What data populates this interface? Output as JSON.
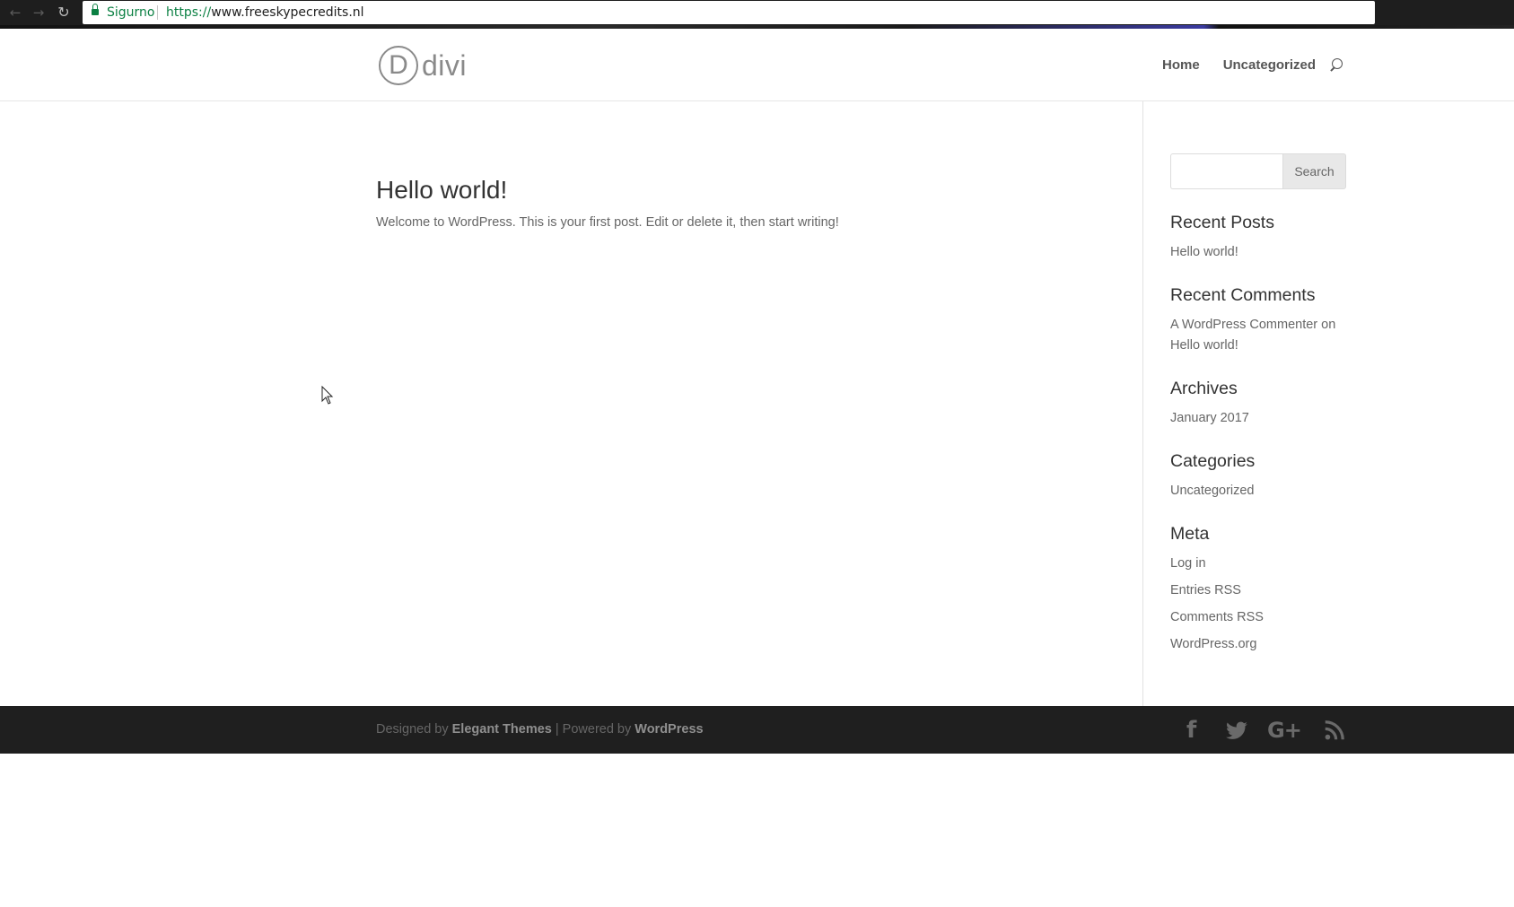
{
  "browser": {
    "back_icon": "arrow-left-icon",
    "forward_icon": "arrow-right-icon",
    "reload_icon": "reload-icon",
    "secure_label": "Sigurno",
    "url_scheme": "https://",
    "url_rest": "www.freeskypecredits.nl"
  },
  "header": {
    "logo_mark": "D",
    "logo_text": "divi",
    "nav": [
      "Home",
      "Uncategorized"
    ],
    "search_icon": "search-icon"
  },
  "post": {
    "title": "Hello world!",
    "excerpt": "Welcome to WordPress. This is your first post. Edit or delete it, then start writing!"
  },
  "sidebar": {
    "search_button": "Search",
    "search_value": "",
    "recent_posts": {
      "title": "Recent Posts",
      "items": [
        "Hello world!"
      ]
    },
    "recent_comments": {
      "title": "Recent Comments",
      "author": "A WordPress Commenter",
      "on": "on",
      "post": "Hello world!"
    },
    "archives": {
      "title": "Archives",
      "items": [
        "January 2017"
      ]
    },
    "categories": {
      "title": "Categories",
      "items": [
        "Uncategorized"
      ]
    },
    "meta": {
      "title": "Meta",
      "items": [
        "Log in",
        "Entries RSS",
        "Comments RSS",
        "WordPress.org"
      ]
    }
  },
  "footer": {
    "designed_by": "Designed by",
    "elegant_themes": "Elegant Themes",
    "separator": "| Powered by",
    "wordpress": "WordPress",
    "social_icons": [
      "facebook-icon",
      "twitter-icon",
      "google-plus-icon",
      "rss-icon"
    ],
    "facebook_glyph": "f",
    "googleplus_glyph": "G+"
  },
  "colors": {
    "footer_bg": "#1f1f1f",
    "text": "#666666",
    "heading": "#333333",
    "secure_green": "#0b8043"
  }
}
